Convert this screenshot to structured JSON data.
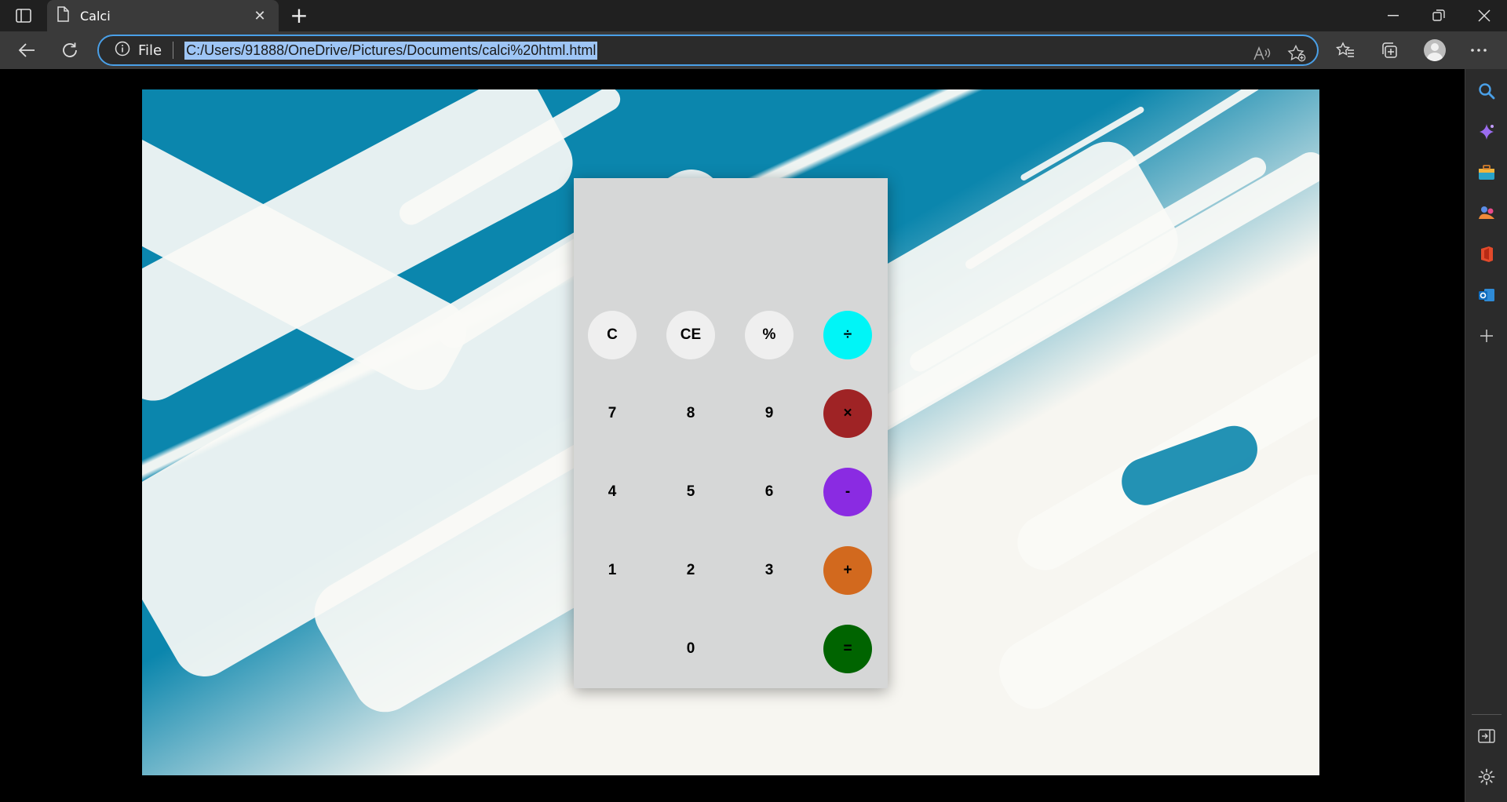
{
  "browser": {
    "tab_title": "Calci",
    "address_prefix": "File",
    "url": "C:/Users/91888/OneDrive/Pictures/Documents/calci%20html.html",
    "accent_color": "#4aa0e8"
  },
  "calculator": {
    "display_value": "",
    "keys": [
      {
        "label": "C",
        "style": "light",
        "name": "clear-button"
      },
      {
        "label": "CE",
        "style": "light",
        "name": "clear-entry-button"
      },
      {
        "label": "%",
        "style": "light",
        "name": "percent-button"
      },
      {
        "label": "÷",
        "style": "op",
        "color": "#00f5f7",
        "name": "divide-button"
      },
      {
        "label": "7",
        "style": "plain",
        "name": "digit-7-button"
      },
      {
        "label": "8",
        "style": "plain",
        "name": "digit-8-button"
      },
      {
        "label": "9",
        "style": "plain",
        "name": "digit-9-button"
      },
      {
        "label": "×",
        "style": "op",
        "color": "#9f2325",
        "name": "multiply-button"
      },
      {
        "label": "4",
        "style": "plain",
        "name": "digit-4-button"
      },
      {
        "label": "5",
        "style": "plain",
        "name": "digit-5-button"
      },
      {
        "label": "6",
        "style": "plain",
        "name": "digit-6-button"
      },
      {
        "label": "-",
        "style": "op",
        "color": "#8a2be2",
        "name": "minus-button"
      },
      {
        "label": "1",
        "style": "plain",
        "name": "digit-1-button"
      },
      {
        "label": "2",
        "style": "plain",
        "name": "digit-2-button"
      },
      {
        "label": "3",
        "style": "plain",
        "name": "digit-3-button"
      },
      {
        "label": "+",
        "style": "op",
        "color": "#d2691e",
        "name": "plus-button"
      },
      {
        "label": "0",
        "style": "plain",
        "name": "digit-0-button"
      },
      {
        "label": "=",
        "style": "op",
        "color": "#006400",
        "name": "equals-button"
      }
    ]
  }
}
